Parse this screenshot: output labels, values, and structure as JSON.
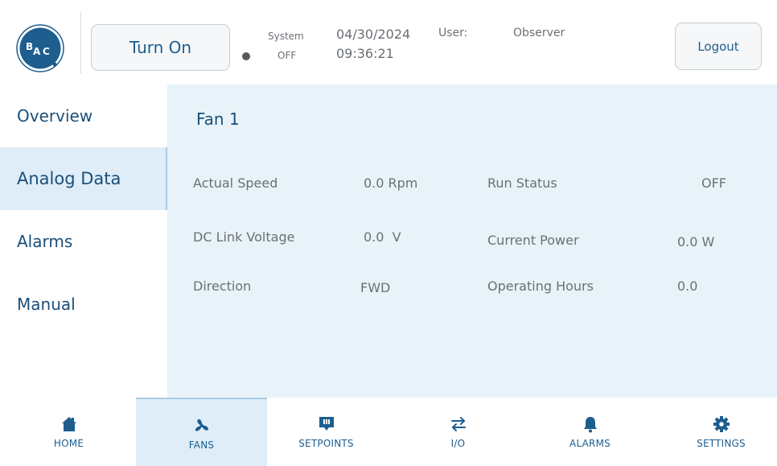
{
  "header": {
    "logo_text": "BAC",
    "turn_on_label": "Turn On",
    "system_label": "System",
    "system_state": "OFF",
    "date": "04/30/2024",
    "time": "09:36:21",
    "user_label": "User:",
    "user_value": "Observer",
    "logout_label": "Logout"
  },
  "sidebar": {
    "items": [
      {
        "label": "Overview",
        "active": false
      },
      {
        "label": "Analog Data",
        "active": true
      },
      {
        "label": "Alarms",
        "active": false
      },
      {
        "label": "Manual",
        "active": false
      }
    ]
  },
  "main": {
    "title": "Fan 1",
    "rows": [
      {
        "left_label": "Actual Speed",
        "left_value": "0.0 Rpm",
        "right_label": "Run Status",
        "right_value": "OFF"
      },
      {
        "left_label": "DC Link Voltage",
        "left_value": "0.0  V",
        "right_label": "Current Power",
        "right_value": "0.0 W"
      },
      {
        "left_label": "Direction",
        "left_value": "FWD",
        "right_label": "Operating Hours",
        "right_value": "0.0"
      }
    ]
  },
  "bottom_nav": {
    "items": [
      {
        "label": "HOME",
        "icon": "home-icon",
        "active": false
      },
      {
        "label": "FANS",
        "icon": "fan-icon",
        "active": true
      },
      {
        "label": "SETPOINTS",
        "icon": "setpoints-icon",
        "active": false
      },
      {
        "label": "I/O",
        "icon": "io-icon",
        "active": false
      },
      {
        "label": "ALARMS",
        "icon": "bell-icon",
        "active": false
      },
      {
        "label": "SETTINGS",
        "icon": "gear-icon",
        "active": false
      }
    ]
  },
  "colors": {
    "accent": "#1d5e8f",
    "panel_bg": "#e8f3f9",
    "active_bg": "#deedf8",
    "text_gray": "#6a6f75"
  }
}
